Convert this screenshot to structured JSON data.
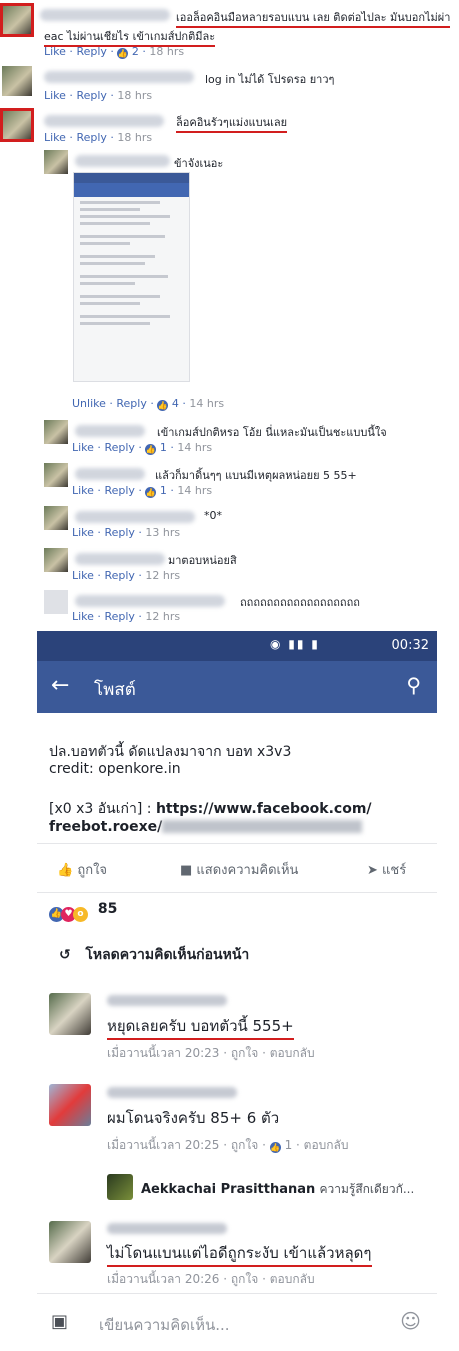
{
  "top_comments": [
    {
      "text": "เออล็อคอินมือหลายรอบแบน เลย ติดต่อไปละ มันบอกไม่ผ่า",
      "text2": "eac ไม่ผ่านเชียไร เข้าเกมส์ปกติมีละ",
      "like": "Like",
      "reply": "Reply",
      "reactions": "2",
      "time": "18 hrs"
    },
    {
      "text": "log in ไม่ได้ โปรดรอ ยาวๆ",
      "like": "Like",
      "reply": "Reply",
      "time": "18 hrs"
    },
    {
      "text": "ล็อคอินรัวๆแม่งแบนเลย",
      "like": "Like",
      "reply": "Reply",
      "time": "18 hrs"
    },
    {
      "text": "ข้าจังเนอะ"
    },
    {
      "unlike": "Unlike",
      "reply": "Reply",
      "reactions": "4",
      "time": "14 hrs"
    },
    {
      "text": "เข้าเกมส์ปกติหรอ โอ้ย นี่แหละมันเป็นชะแบบนี้ใจ",
      "like": "Like",
      "reply": "Reply",
      "reactions": "1",
      "time": "14 hrs"
    },
    {
      "text": "แล้วก็มาดิ้นๆๆ แบนมีเหตุผลหน่อยย 5 55+",
      "like": "Like",
      "reply": "Reply",
      "reactions": "1",
      "time": "14 hrs"
    },
    {
      "text": "*0*",
      "like": "Like",
      "reply": "Reply",
      "time": "13 hrs"
    },
    {
      "text": "มาตอบหน่อยสิ",
      "like": "Like",
      "reply": "Reply",
      "time": "12 hrs"
    },
    {
      "text": "ถถถถถถถถถถถถถถถถถถ",
      "like": "Like",
      "reply": "Reply",
      "time": "12 hrs"
    }
  ],
  "mobile": {
    "time": "00:32",
    "title": "โพสต์",
    "post_line1": "ปล.บอทตัวนี้ ดัดแปลงมาจาก บอท x3v3",
    "post_line2": "credit: openkore.in",
    "post_line3_a": "[x0 x3 อันเก่า] : ",
    "post_line3_b": "https://www.facebook.com/",
    "post_line4": "freebot.roexe/",
    "like_action": "ถูกใจ",
    "comment_action": "แสดงความคิดเห็น",
    "share_action": "แชร์",
    "reaction_count": "85",
    "load_previous": "โหลดความคิดเห็นก่อนหน้า",
    "comments": [
      {
        "text": "หยุดเลยครับ บอทตัวนี้ 555+",
        "meta": "เมื่อวานนี้เวลา 20:23  ·  ถูกใจ  ·  ตอบกลับ"
      },
      {
        "text": "ผมโดนจริงครับ 85+ 6 ตัว",
        "meta_a": "เมื่อวานนี้เวลา 20:25  ·  ถูกใจ  ·  ",
        "meta_b": "1",
        "meta_c": "  ·  ตอบกลับ"
      },
      {
        "name": "Aekkachai Prasitthanan",
        "text": "ความรู้สึกเดียวกั..."
      },
      {
        "text": "ไม่โดนแบนแต่ไอดีถูกระงับ เข้าแล้วหลุดๆ",
        "meta": "เมื่อวานนี้เวลา 20:26  ·  ถูกใจ  ·  ตอบกลับ"
      }
    ],
    "composer_placeholder": "เขียนความคิดเห็น..."
  }
}
